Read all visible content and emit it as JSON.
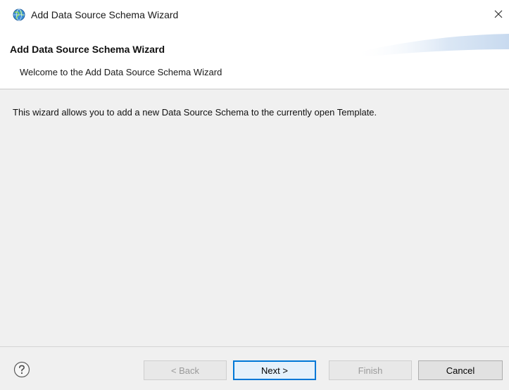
{
  "window": {
    "title": "Add Data Source Schema Wizard",
    "icon": "globe-icon"
  },
  "header": {
    "title": "Add Data Source Schema Wizard",
    "subtitle": "Welcome to the Add Data Source Schema Wizard"
  },
  "content": {
    "description": "This wizard allows you to add a new Data Source Schema to the currently open Template."
  },
  "footer": {
    "help_icon": "question-mark-icon",
    "buttons": {
      "back": "< Back",
      "next": "Next >",
      "finish": "Finish",
      "cancel": "Cancel"
    }
  },
  "colors": {
    "content_background": "#f0f0f0",
    "default_button_border": "#0078d7",
    "disabled_text": "#9a9a9a"
  }
}
